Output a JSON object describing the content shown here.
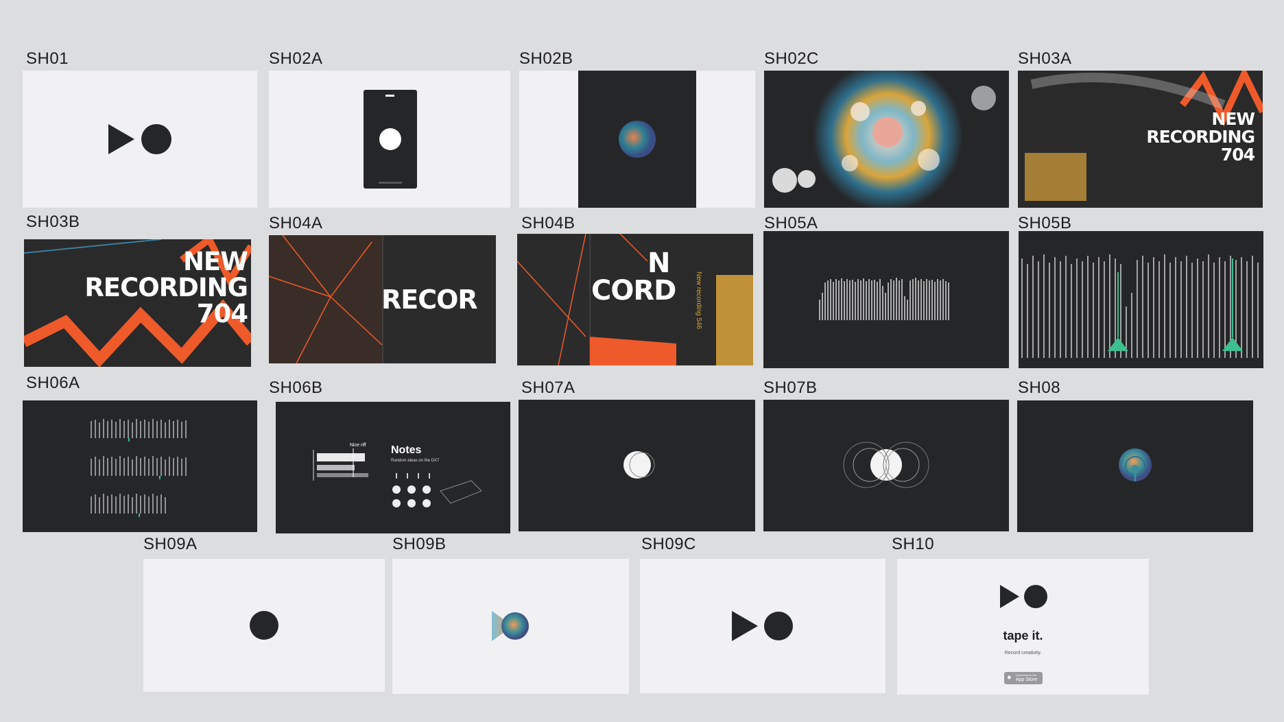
{
  "shots": [
    {
      "label": "SH01"
    },
    {
      "label": "SH02A"
    },
    {
      "label": "SH02B"
    },
    {
      "label": "SH02C"
    },
    {
      "label": "SH03A"
    },
    {
      "label": "SH03B"
    },
    {
      "label": "SH04A"
    },
    {
      "label": "SH04B"
    },
    {
      "label": "SH05A"
    },
    {
      "label": "SH05B"
    },
    {
      "label": "SH06A"
    },
    {
      "label": "SH06B"
    },
    {
      "label": "SH07A"
    },
    {
      "label": "SH07B"
    },
    {
      "label": "SH08"
    },
    {
      "label": "SH09A"
    },
    {
      "label": "SH09B"
    },
    {
      "label": "SH09C"
    },
    {
      "label": "SH10"
    }
  ],
  "recording": {
    "line1": "NEW",
    "line2": "RECORDING",
    "line3": "704",
    "partial_recor": "RECOR",
    "partial_n": "N",
    "partial_cord": "CORD",
    "partial_ecor": "ECOR"
  },
  "vertical_text": "New recording 546",
  "notes": {
    "title": "Notes",
    "subtitle": "Random ideas on the DX7",
    "tag": "Nice riff"
  },
  "end_card": {
    "name": "tape it.",
    "tagline": "Record creativity.",
    "store_small": "Download on the",
    "store": "App Store"
  },
  "colors": {
    "bg": "#dcdddf",
    "dark": "#252628",
    "light": "#f1f1f4",
    "accent_orange": "#ef5a2a",
    "accent_green": "#3dbf8f",
    "accent_gold": "#d9a43b"
  }
}
